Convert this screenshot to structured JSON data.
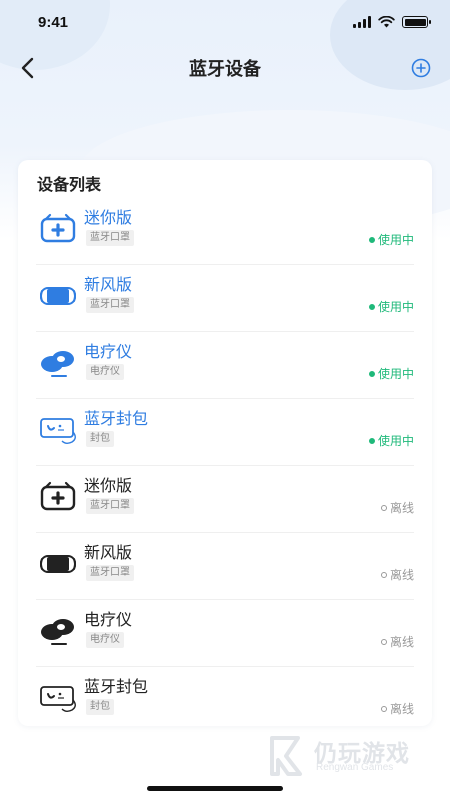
{
  "status_bar": {
    "time": "9:41"
  },
  "nav": {
    "title": "蓝牙设备"
  },
  "card": {
    "title": "设备列表"
  },
  "devices": [
    {
      "name": "迷你版",
      "tag": "蓝牙口罩",
      "status": "使用中",
      "online": true,
      "icon": "mini-mask-icon"
    },
    {
      "name": "新风版",
      "tag": "蓝牙口罩",
      "status": "使用中",
      "online": true,
      "icon": "fresh-air-mask-icon"
    },
    {
      "name": "电疗仪",
      "tag": "电疗仪",
      "status": "使用中",
      "online": true,
      "icon": "therapy-device-icon"
    },
    {
      "name": "蓝牙封包",
      "tag": "封包",
      "status": "使用中",
      "online": true,
      "icon": "bluetooth-pack-icon"
    },
    {
      "name": "迷你版",
      "tag": "蓝牙口罩",
      "status": "离线",
      "online": false,
      "icon": "mini-mask-icon"
    },
    {
      "name": "新风版",
      "tag": "蓝牙口罩",
      "status": "离线",
      "online": false,
      "icon": "fresh-air-mask-icon"
    },
    {
      "name": "电疗仪",
      "tag": "电疗仪",
      "status": "离线",
      "online": false,
      "icon": "therapy-device-icon"
    },
    {
      "name": "蓝牙封包",
      "tag": "封包",
      "status": "离线",
      "online": false,
      "icon": "bluetooth-pack-icon"
    }
  ],
  "colors": {
    "online_name": "#2f7de1",
    "online_status": "#1fb97a",
    "offline_status": "#999999",
    "icon_online": "#2f7de1",
    "icon_offline": "#222222"
  },
  "watermark": {
    "text": "仍玩游戏",
    "sub": "Rengwan Games"
  }
}
